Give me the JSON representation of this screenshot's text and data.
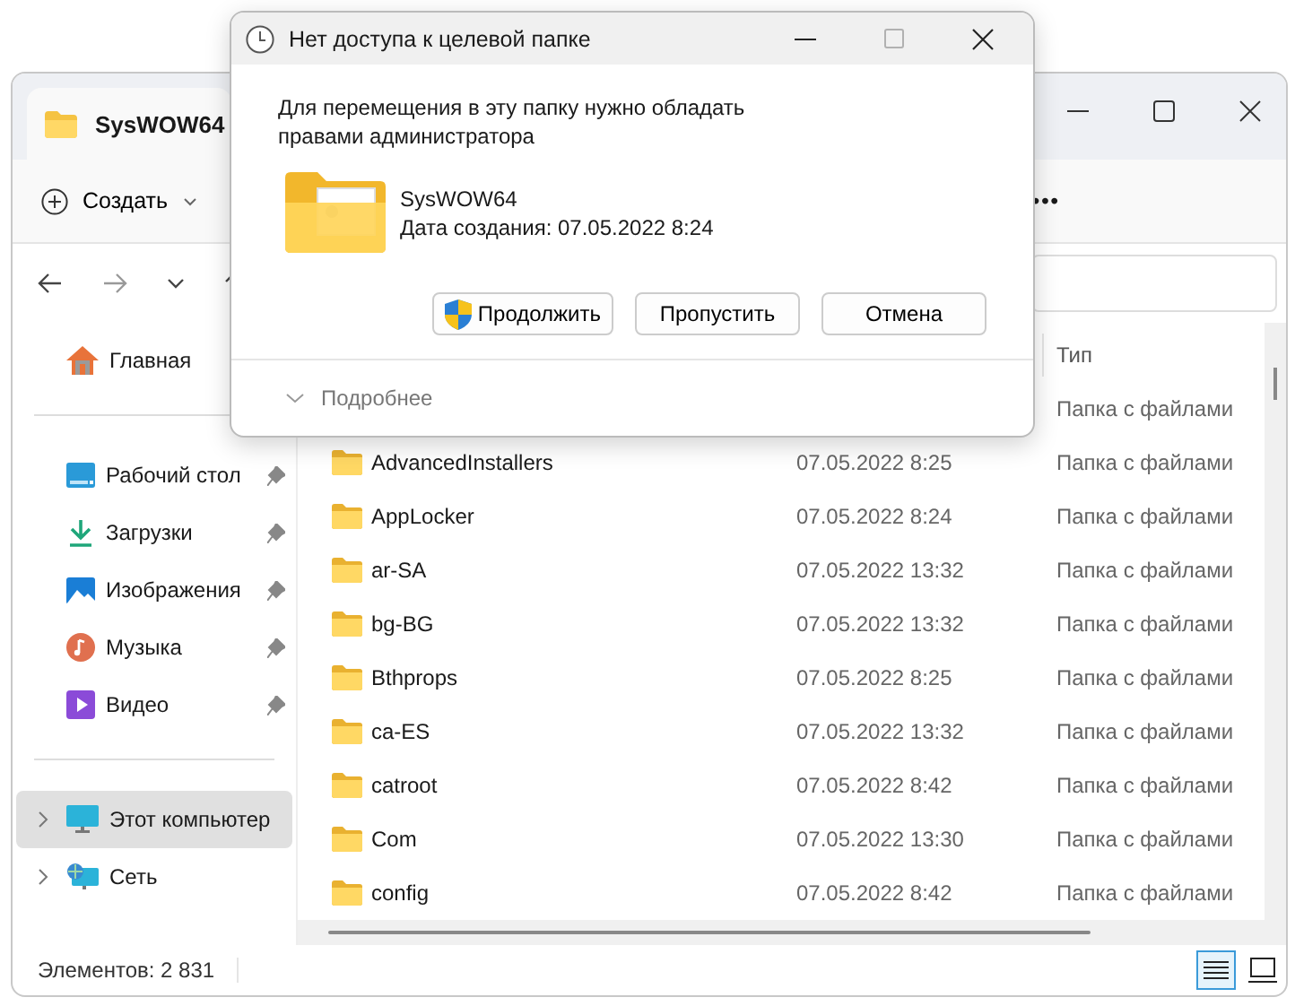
{
  "explorer": {
    "tab": {
      "title": "SysWOW64",
      "selected": true
    },
    "toolbar": {
      "new_button": "Создать",
      "more": "•••"
    },
    "sidebar": {
      "home": [
        {
          "label": "Главная",
          "kind": "home",
          "selected": false
        }
      ],
      "quick_access": [
        {
          "label": "Рабочий стол",
          "kind": "desktop",
          "pinned": true,
          "selected": false
        },
        {
          "label": "Загрузки",
          "kind": "download",
          "pinned": true,
          "selected": false
        },
        {
          "label": "Изображения",
          "kind": "pictures",
          "pinned": true,
          "selected": false
        },
        {
          "label": "Музыка",
          "kind": "music",
          "pinned": true,
          "selected": false
        },
        {
          "label": "Видео",
          "kind": "video",
          "pinned": true,
          "selected": false
        }
      ],
      "locations": [
        {
          "label": "Этот компьютер",
          "kind": "pc",
          "selected": true
        },
        {
          "label": "Сеть",
          "kind": "network",
          "selected": false
        }
      ]
    },
    "table": {
      "type_header": "Тип",
      "rows": [
        {
          "type": "Папка с файлами"
        },
        {
          "name": "AdvancedInstallers",
          "date": "07.05.2022 8:25",
          "type": "Папка с файлами"
        },
        {
          "name": "AppLocker",
          "date": "07.05.2022 8:24",
          "type": "Папка с файлами"
        },
        {
          "name": "ar-SA",
          "date": "07.05.2022 13:32",
          "type": "Папка с файлами"
        },
        {
          "name": "bg-BG",
          "date": "07.05.2022 13:32",
          "type": "Папка с файлами"
        },
        {
          "name": "Bthprops",
          "date": "07.05.2022 8:25",
          "type": "Папка с файлами"
        },
        {
          "name": "ca-ES",
          "date": "07.05.2022 13:32",
          "type": "Папка с файлами"
        },
        {
          "name": "catroot",
          "date": "07.05.2022 8:42",
          "type": "Папка с файлами"
        },
        {
          "name": "Com",
          "date": "07.05.2022 13:30",
          "type": "Папка с файлами"
        },
        {
          "name": "config",
          "date": "07.05.2022 8:42",
          "type": "Папка с файлами"
        }
      ]
    },
    "status_bar": {
      "count": "Элементов: 2 831",
      "views": [
        {
          "kind": "details",
          "selected": true
        },
        {
          "kind": "tiles",
          "selected": false
        }
      ]
    }
  },
  "dialog": {
    "title": "Нет доступа к целевой папке",
    "maximize_disabled": true,
    "message": "Для перемещения в эту папку нужно обладать правами администратора",
    "folder_name": "SysWOW64",
    "created": "Дата создания: 07.05.2022 8:24",
    "buttons": [
      {
        "label": "Продолжить",
        "kind": "shield"
      },
      {
        "label": "Пропустить",
        "kind": "plain"
      },
      {
        "label": "Отмена",
        "kind": "plain"
      }
    ],
    "details": "Подробнее"
  }
}
